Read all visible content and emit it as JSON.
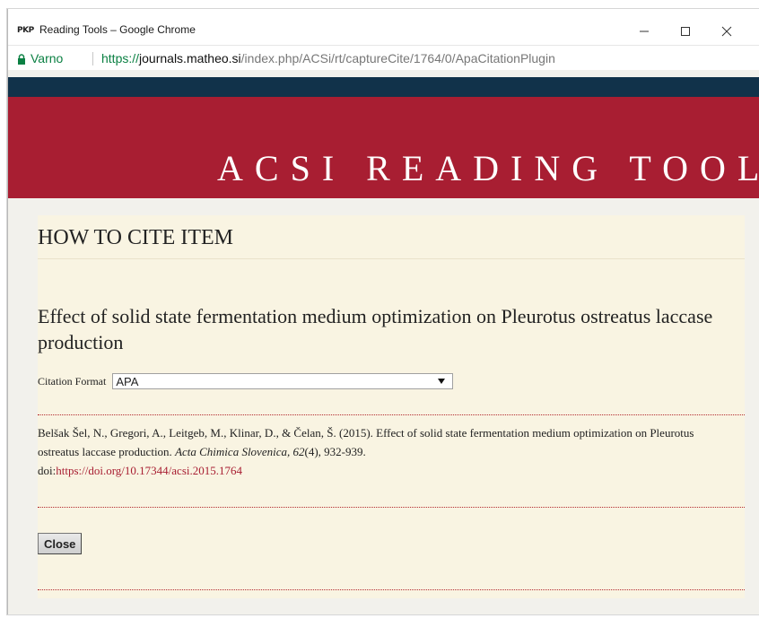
{
  "window": {
    "app_icon_text": "PKP",
    "title": "Reading Tools – Google Chrome",
    "controls": {
      "minimize": "–",
      "maximize": "□",
      "close": "✕"
    }
  },
  "addressbar": {
    "secure_label": "Varno",
    "url_scheme": "https://",
    "url_host": "journals.matheo.si",
    "url_path": "/index.php/ACSi/rt/captureCite/1764/0/ApaCitationPlugin"
  },
  "header": {
    "title": "ACSI READING TOOLS"
  },
  "main": {
    "heading": "HOW TO CITE ITEM",
    "article_title": "Effect of solid state fermentation medium optimization on Pleurotus ostreatus laccase production",
    "citation_format_label": "Citation Format",
    "citation_format_value": "APA",
    "citation": {
      "authors_year": "Belšak Šel, N., Gregori, A., Leitgeb, M., Klinar, D., & Čelan, Š. (2015). Effect of solid state fermentation medium optimization on Pleurotus ostreatus laccase production. ",
      "journal": "Acta Chimica Slovenica, 62",
      "issue_pages": "(4), 932-939.",
      "doi_prefix": "doi:",
      "doi_link": "https://doi.org/10.17344/acsi.2015.1764"
    },
    "close_label": "Close"
  },
  "icons": {
    "lock": "lock-icon",
    "dropdown": "dropdown-arrow-icon"
  },
  "colors": {
    "header_red": "#a81e32",
    "nav_navy": "#11324a",
    "content_bg": "#f9f4e2",
    "secure_green": "#0b8043",
    "link_red": "#a81e32"
  }
}
